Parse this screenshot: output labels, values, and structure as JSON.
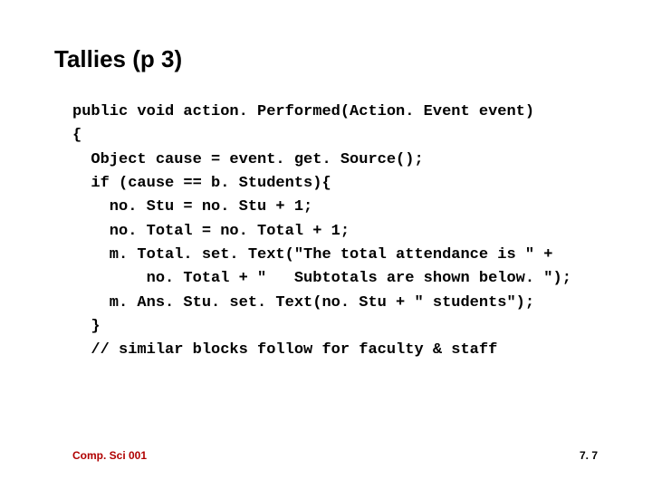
{
  "title": "Tallies (p 3)",
  "code": "public void action. Performed(Action. Event event)\n{\n  Object cause = event. get. Source();\n  if (cause == b. Students){\n    no. Stu = no. Stu + 1;\n    no. Total = no. Total + 1;\n    m. Total. set. Text(\"The total attendance is \" +\n        no. Total + \"   Subtotals are shown below. \");\n    m. Ans. Stu. set. Text(no. Stu + \" students\");\n  }\n  // similar blocks follow for faculty & staff",
  "footer_left": "Comp. Sci 001",
  "footer_right": "7. 7"
}
